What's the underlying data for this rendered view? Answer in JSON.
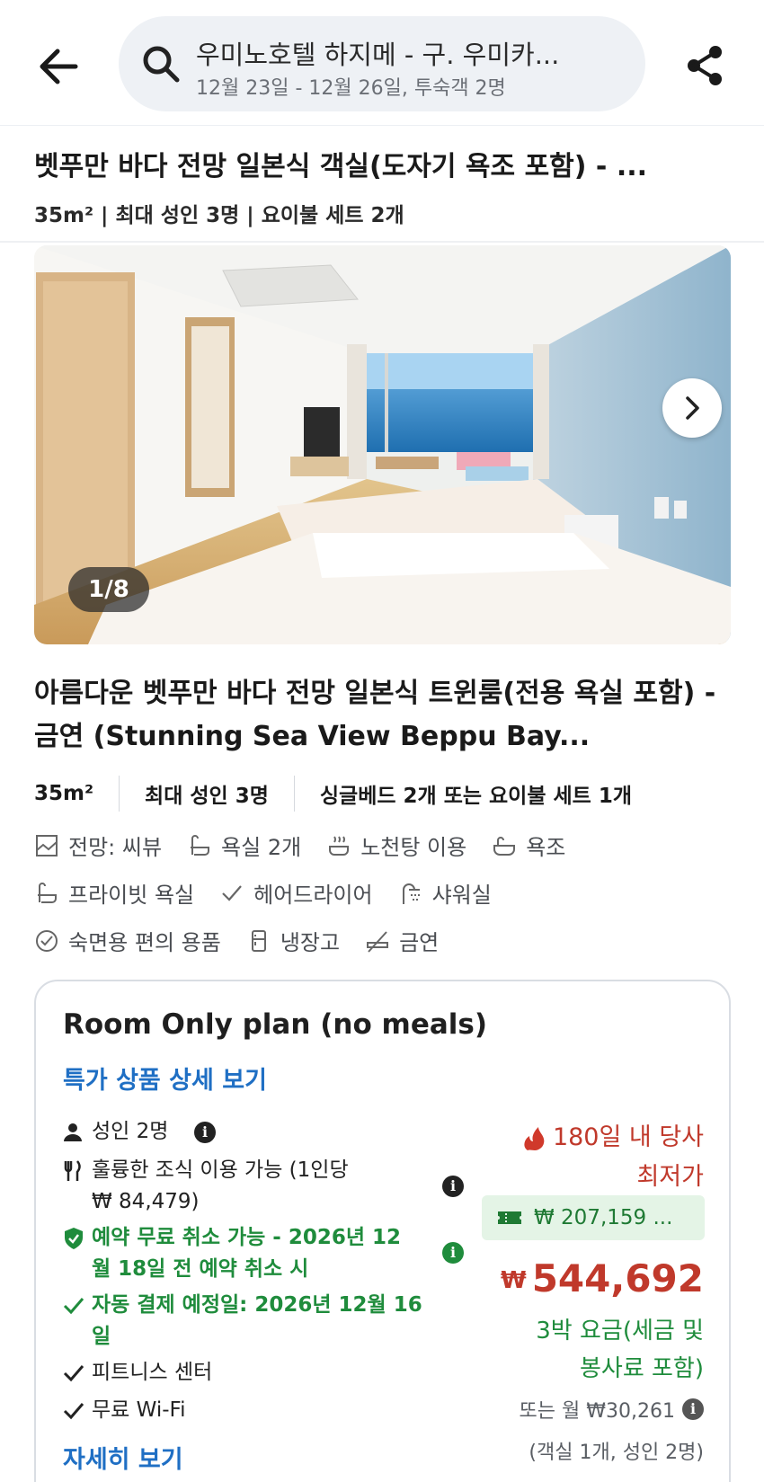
{
  "search": {
    "title": "우미노호텔 하지메 - 구. 우미카...",
    "subtitle": "12월 23일 - 12월 26일, 투숙객 2명"
  },
  "room": {
    "title": "벳푸만 바다 전망 일본식 객실(도자기 욕조 포함) - ...",
    "meta": "35m² | 최대 성인 3명 | 요이불 세트 2개"
  },
  "gallery": {
    "counter": "1/8"
  },
  "detail": {
    "description": "아름다운 벳푸만 바다 전망 일본식 트윈룸(전용 욕실 포함) - 금연 (Stunning Sea View Beppu Bay...",
    "specs": [
      "35m²",
      "최대 성인 3명",
      "싱글베드 2개 또는 요이불 세트 1개"
    ],
    "amenities": [
      {
        "label": "전망: 씨뷰",
        "icon": "view-icon"
      },
      {
        "label": "욕실 2개",
        "icon": "bath-icon"
      },
      {
        "label": "노천탕 이용",
        "icon": "hot-spring-icon"
      },
      {
        "label": "욕조",
        "icon": "bathtub-icon"
      },
      {
        "label": "프라이빗 욕실",
        "icon": "bath-icon"
      },
      {
        "label": "헤어드라이어",
        "icon": "check-icon"
      },
      {
        "label": "샤워실",
        "icon": "shower-icon"
      },
      {
        "label": "숙면용 편의 용품",
        "icon": "check-circle-icon"
      },
      {
        "label": "냉장고",
        "icon": "fridge-icon"
      },
      {
        "label": "금연",
        "icon": "no-smoking-icon"
      }
    ]
  },
  "offer": {
    "plan_title": "Room Only plan (no meals)",
    "plan_link": "특가 상품 상세 보기",
    "features": {
      "adults": "성인 2명",
      "breakfast_line1": "훌륭한 조식 이용 가능 (1인당",
      "breakfast_line2": "₩ 84,479)",
      "cancel_line1": "예약 무료 취소 가능 - 2026년 12",
      "cancel_line2": "월 18일 전 예약 취소 시",
      "payment_line1": "자동 결제 예정일: 2026년 12월 16",
      "payment_line2": "일",
      "fitness": "피트니스 센터",
      "wifi": "무료 Wi-Fi"
    },
    "more_link": "자세히 보기",
    "deal_line1": "180일 내 당사",
    "deal_line2": "최저가",
    "coupon": "₩ 207,159 ...",
    "currency": "₩",
    "price": "544,692",
    "price_note_line1": "3박 요금(세금 및",
    "price_note_line2": "봉사료 포함)",
    "monthly": "또는 월 ₩30,261",
    "guests": "(객실 1개, 성인 2명)"
  },
  "colors": {
    "link": "#1f6fc4",
    "price_red": "#c0392b",
    "green": "#1f8c3c"
  }
}
